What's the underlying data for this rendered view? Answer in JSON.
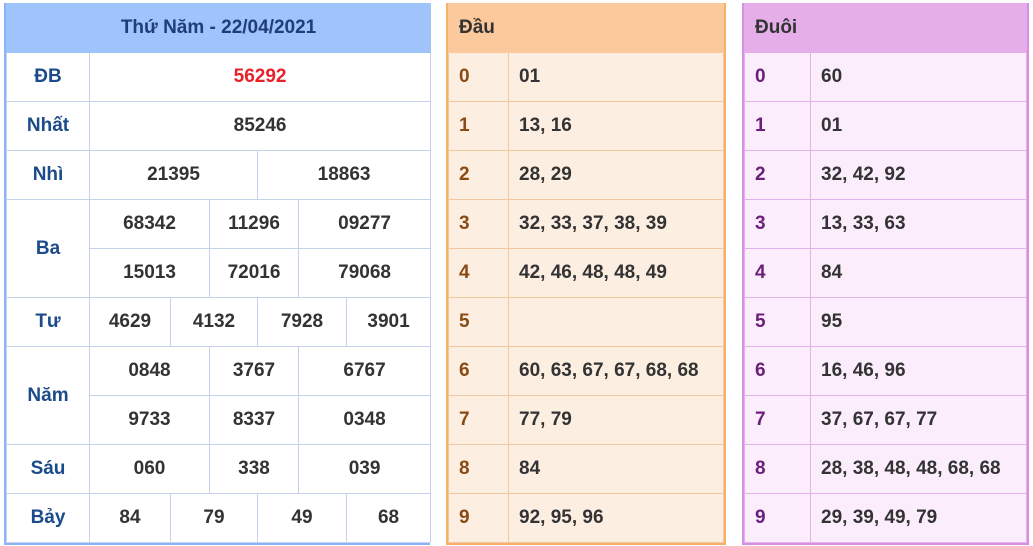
{
  "results": {
    "title": "Thứ Năm - 22/04/2021",
    "special": {
      "label": "ĐB",
      "value": "56292"
    },
    "first": {
      "label": "Nhất",
      "value": "85246"
    },
    "second": {
      "label": "Nhì",
      "values": [
        "21395",
        "18863"
      ]
    },
    "third": {
      "label": "Ba",
      "values": [
        "68342",
        "11296",
        "09277",
        "15013",
        "72016",
        "79068"
      ]
    },
    "fourth": {
      "label": "Tư",
      "values": [
        "4629",
        "4132",
        "7928",
        "3901"
      ]
    },
    "fifth": {
      "label": "Năm",
      "values": [
        "0848",
        "3767",
        "6767",
        "9733",
        "8337",
        "0348"
      ]
    },
    "sixth": {
      "label": "Sáu",
      "values": [
        "060",
        "338",
        "039"
      ]
    },
    "seventh": {
      "label": "Bảy",
      "values": [
        "84",
        "79",
        "49",
        "68"
      ]
    }
  },
  "dau": {
    "header": "Đầu",
    "rows": [
      {
        "digit": "0",
        "values": "01"
      },
      {
        "digit": "1",
        "values": "13, 16"
      },
      {
        "digit": "2",
        "values": "28, 29"
      },
      {
        "digit": "3",
        "values": "32, 33, 37, 38, 39"
      },
      {
        "digit": "4",
        "values": "42, 46, 48, 48, 49"
      },
      {
        "digit": "5",
        "values": ""
      },
      {
        "digit": "6",
        "values": "60, 63, 67, 67, 68, 68"
      },
      {
        "digit": "7",
        "values": "77, 79"
      },
      {
        "digit": "8",
        "values": "84"
      },
      {
        "digit": "9",
        "values": "92, 95, 96"
      }
    ]
  },
  "duoi": {
    "header": "Đuôi",
    "rows": [
      {
        "digit": "0",
        "values": "60"
      },
      {
        "digit": "1",
        "values": "01"
      },
      {
        "digit": "2",
        "values": "32, 42, 92"
      },
      {
        "digit": "3",
        "values": "13, 33, 63"
      },
      {
        "digit": "4",
        "values": "84"
      },
      {
        "digit": "5",
        "values": "95"
      },
      {
        "digit": "6",
        "values": "16, 46, 96"
      },
      {
        "digit": "7",
        "values": "37, 67, 67, 77"
      },
      {
        "digit": "8",
        "values": "28, 38, 48, 48, 68, 68"
      },
      {
        "digit": "9",
        "values": "29, 39, 49, 79"
      }
    ]
  },
  "colors": {
    "special_value": "#e8202a",
    "results_header": "#9ec4fb",
    "dau_header": "#fbc99c",
    "duoi_header": "#e6aee9"
  }
}
